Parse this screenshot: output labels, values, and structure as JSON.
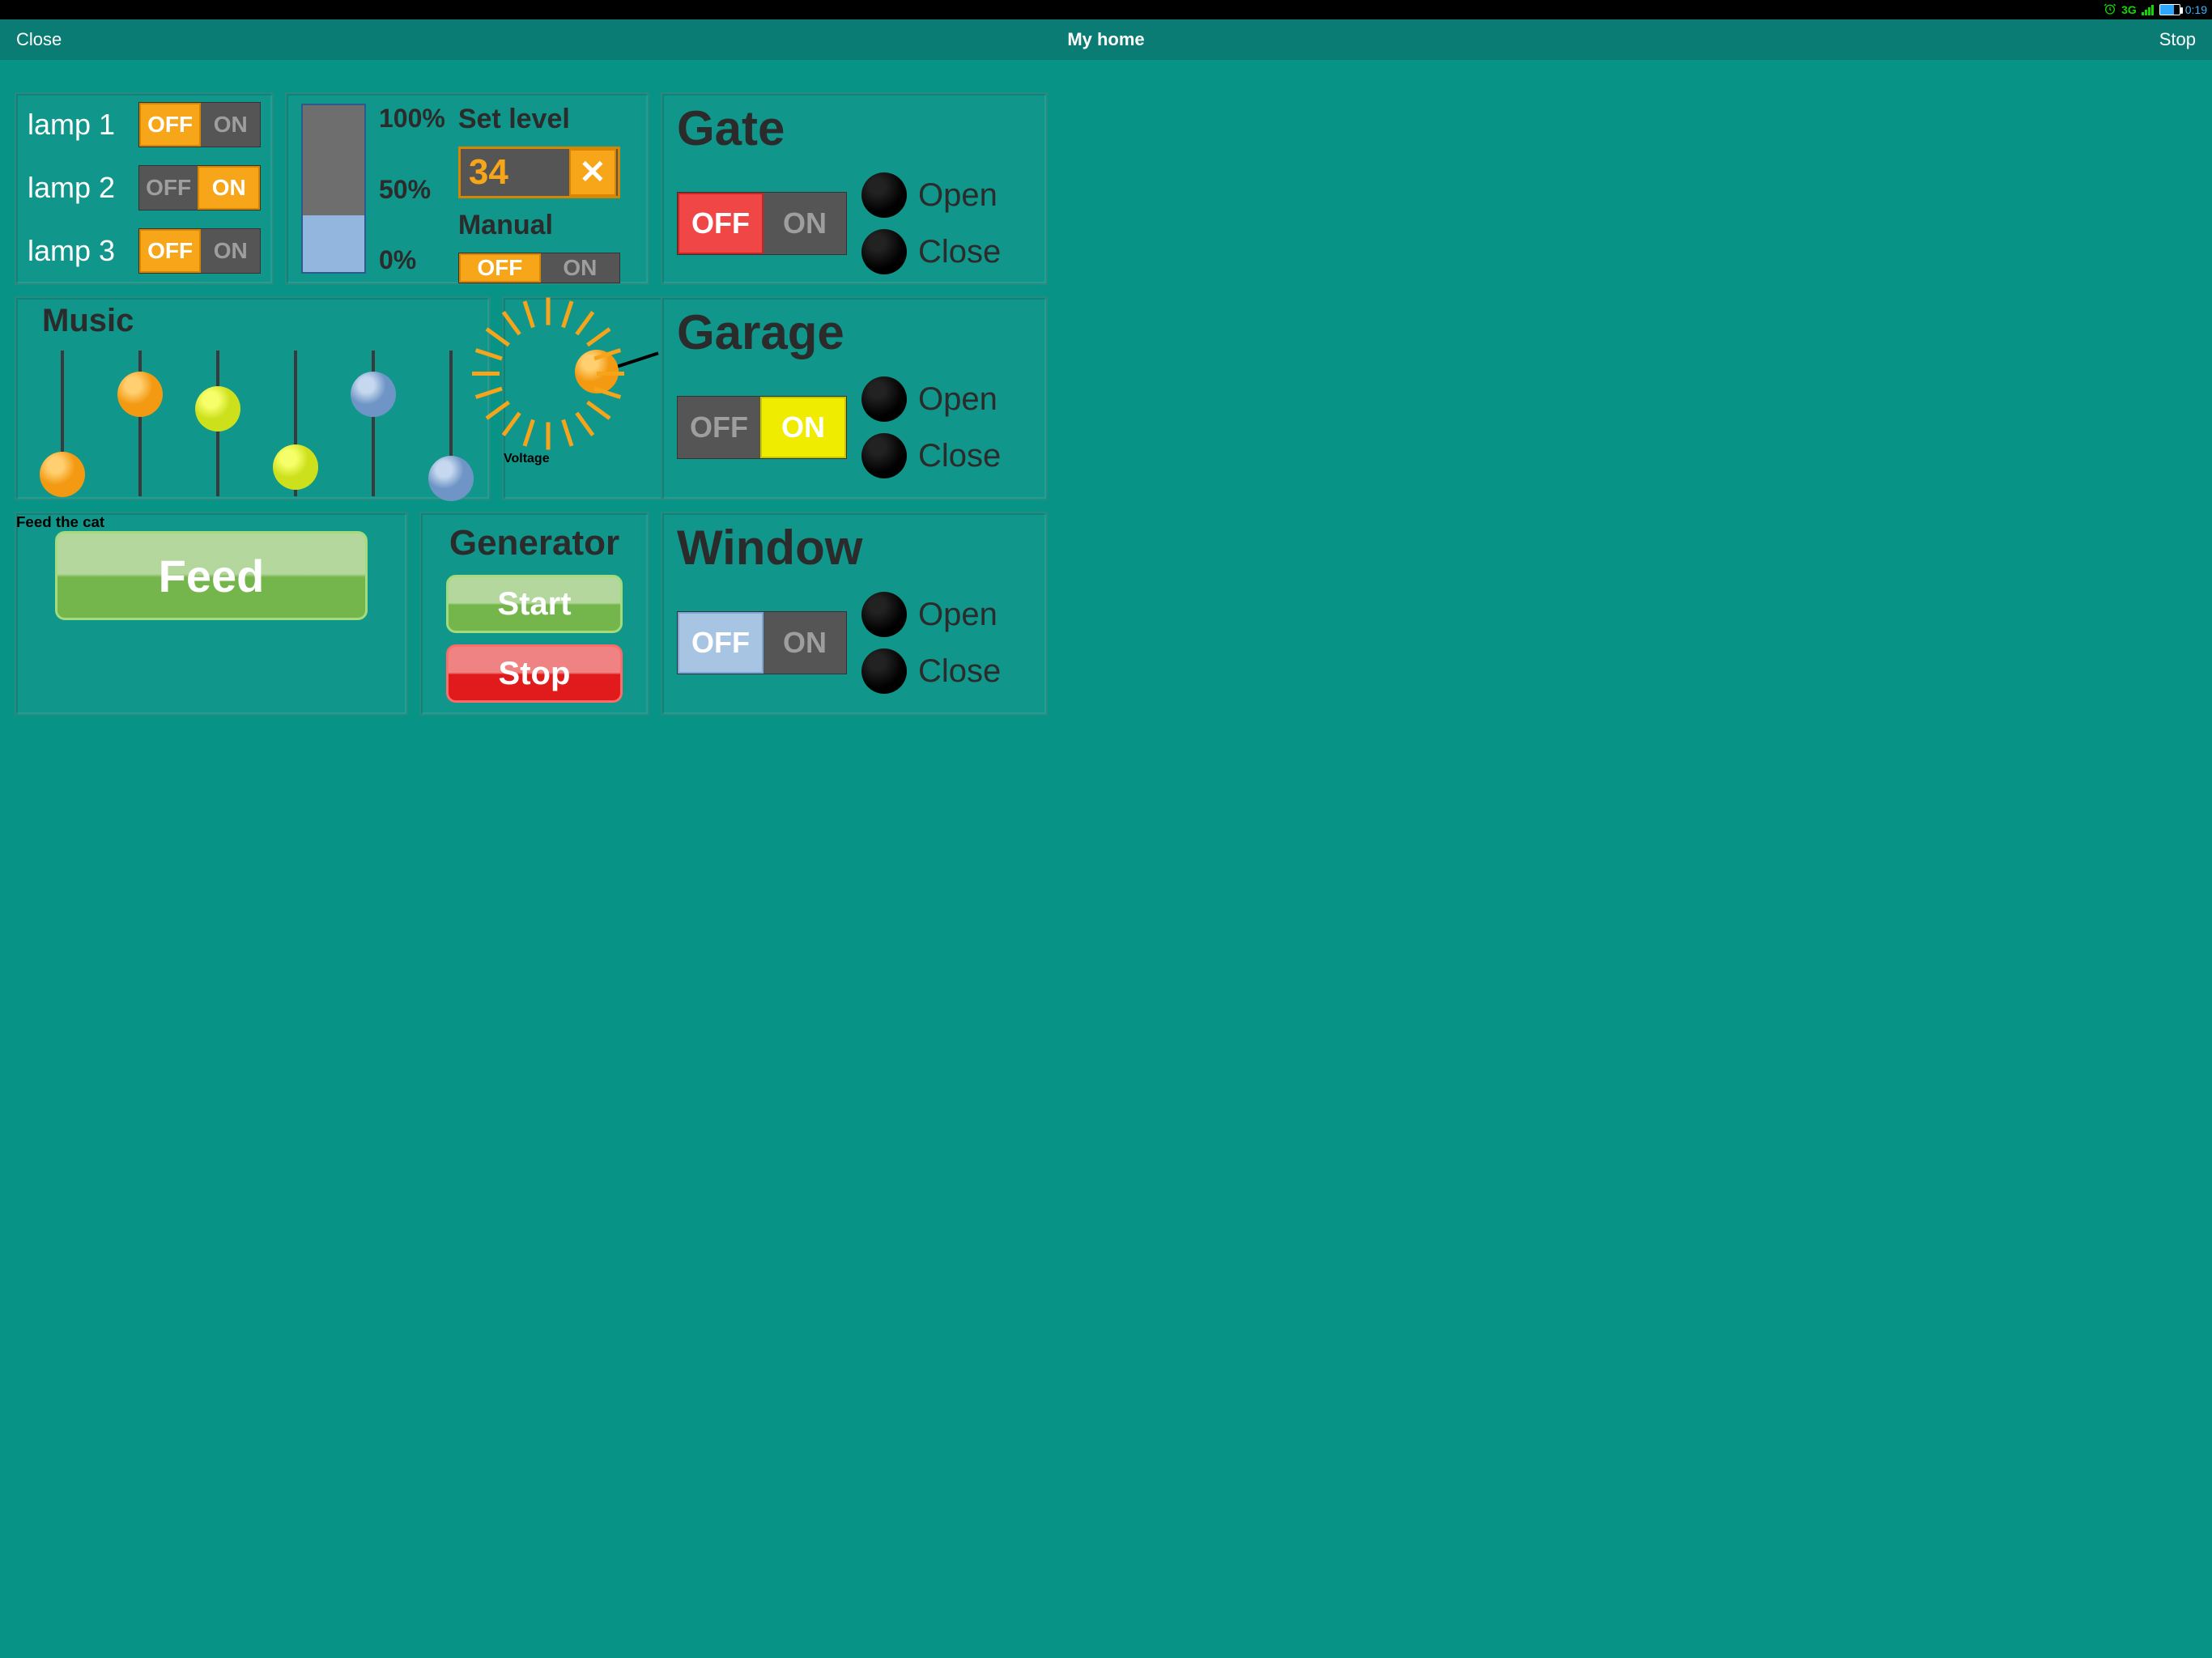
{
  "statusbar": {
    "network": "3G",
    "clock": "0:19"
  },
  "appbar": {
    "left": "Close",
    "title": "My home",
    "right": "Stop"
  },
  "toggle": {
    "off": "OFF",
    "on": "ON"
  },
  "lamps": [
    {
      "name": "lamp 1",
      "state": "off"
    },
    {
      "name": "lamp 2",
      "state": "on"
    },
    {
      "name": "lamp 3",
      "state": "off"
    }
  ],
  "level": {
    "percent": 34,
    "scale": [
      "100%",
      "50%",
      "0%"
    ],
    "set_label": "Set level",
    "value": "34",
    "manual_label": "Manual",
    "manual_state": "off"
  },
  "music": {
    "title": "Music",
    "sliders": [
      {
        "color": "orange",
        "pos": 85
      },
      {
        "color": "orange",
        "pos": 30
      },
      {
        "color": "yellow",
        "pos": 40
      },
      {
        "color": "yellow",
        "pos": 80
      },
      {
        "color": "blue",
        "pos": 30
      },
      {
        "color": "blue",
        "pos": 88
      }
    ]
  },
  "voltage": {
    "label": "Voltage"
  },
  "feed": {
    "title": "Feed the cat",
    "button": "Feed"
  },
  "generator": {
    "title": "Generator",
    "start": "Start",
    "stop": "Stop"
  },
  "doors": {
    "open": "Open",
    "close": "Close",
    "gate": {
      "title": "Gate",
      "state": "off",
      "accent": "red"
    },
    "garage": {
      "title": "Garage",
      "state": "on",
      "accent": "yellow"
    },
    "window": {
      "title": "Window",
      "state": "off",
      "accent": "blue"
    }
  }
}
